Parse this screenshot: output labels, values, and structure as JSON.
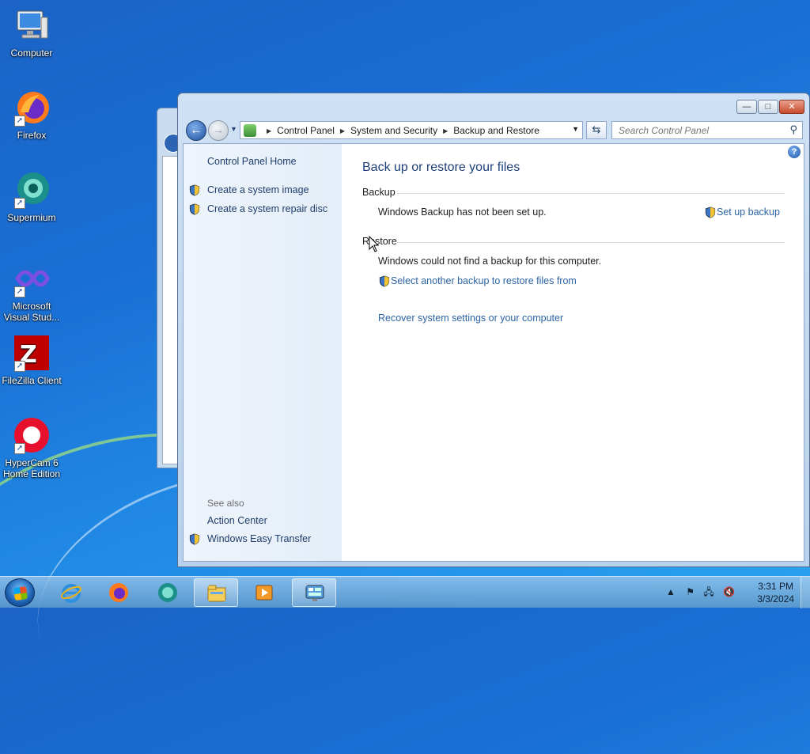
{
  "desktop": {
    "icons": [
      {
        "label": "Computer",
        "icon": "computer-icon"
      },
      {
        "label": "Firefox",
        "icon": "firefox-icon"
      },
      {
        "label": "Supermium",
        "icon": "supermium-icon"
      },
      {
        "label": "Microsoft\nVisual Stud...",
        "icon": "visual-studio-icon"
      },
      {
        "label": "FileZilla Client",
        "icon": "filezilla-icon"
      },
      {
        "label": "HyperCam 6\nHome Edition",
        "icon": "hypercam-icon"
      }
    ]
  },
  "window": {
    "caption_buttons": {
      "minimize": "—",
      "maximize": "□",
      "close": "✕"
    },
    "address": {
      "crumbs": [
        "Control Panel",
        "System and Security",
        "Backup and Restore"
      ]
    },
    "search": {
      "placeholder": "Search Control Panel"
    },
    "left": {
      "home": "Control Panel Home",
      "tasks": [
        "Create a system image",
        "Create a system repair disc"
      ],
      "see_also_label": "See also",
      "see_also": [
        "Action Center",
        "Windows Easy Transfer"
      ]
    },
    "main": {
      "title": "Back up or restore your files",
      "backup": {
        "heading": "Backup",
        "status": "Windows Backup has not been set up.",
        "action": "Set up backup"
      },
      "restore": {
        "heading": "Restore",
        "status": "Windows could not find a backup for this computer.",
        "select_link": "Select another backup to restore files from",
        "recover_link": "Recover system settings or your computer"
      }
    }
  },
  "taskbar": {
    "items": [
      "internet-explorer-icon",
      "firefox-icon",
      "supermium-icon",
      "windows-explorer-icon",
      "media-player-icon",
      "control-panel-icon"
    ],
    "clock": {
      "time": "3:31 PM",
      "date": "3/3/2024"
    }
  },
  "colors": {
    "link": "#2b63a4",
    "title": "#1e3f78",
    "nav_text": "#1e3d6b"
  }
}
